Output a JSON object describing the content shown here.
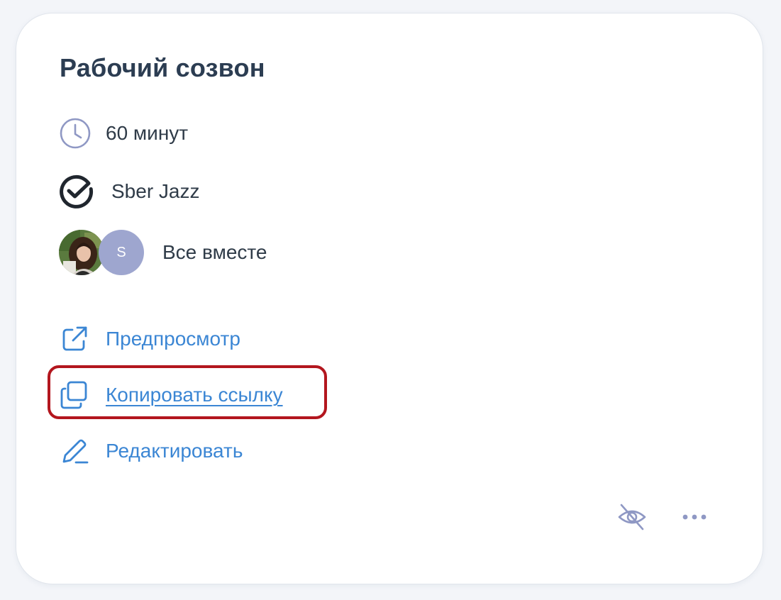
{
  "card": {
    "title": "Рабочий созвон",
    "duration": {
      "icon": "clock-icon",
      "text": "60 минут"
    },
    "platform": {
      "icon": "sber-jazz-check-icon",
      "text": "Sber Jazz"
    },
    "participants": {
      "avatars": [
        {
          "type": "photo"
        },
        {
          "type": "letter",
          "letter": "S"
        }
      ],
      "text": "Все вместе"
    },
    "actions": [
      {
        "icon": "external-link-icon",
        "label": "Предпросмотр"
      },
      {
        "icon": "copy-icon",
        "label": "Копировать ссылку",
        "underlined": true,
        "highlighted": true
      },
      {
        "icon": "pencil-icon",
        "label": "Редактировать"
      }
    ],
    "footer": {
      "hide_icon": "eye-off-icon",
      "more_icon": "more-dots-icon"
    }
  },
  "colors": {
    "background": "#f3f5f9",
    "card": "#ffffff",
    "title": "#2c3d52",
    "text": "#2f3b48",
    "link": "#3b86d4",
    "icon_muted": "#8f98c4",
    "avatar_letter_bg": "#9ea6cf",
    "highlight": "#b3161e"
  }
}
